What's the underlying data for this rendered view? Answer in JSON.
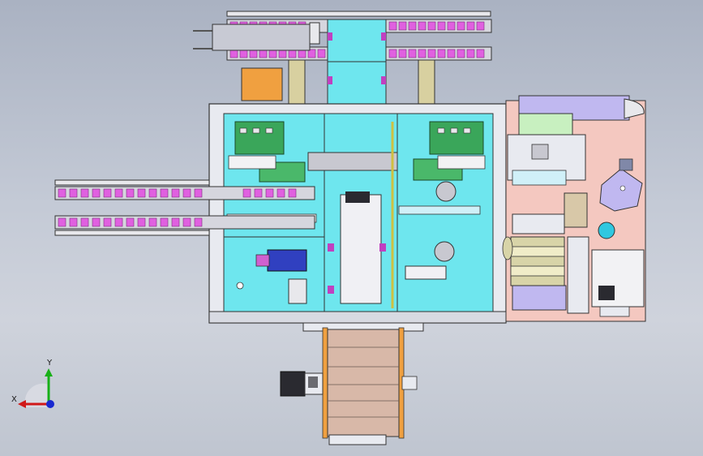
{
  "viewport": {
    "background": "#c4cad6"
  },
  "axis_triad": {
    "x_label": "X",
    "y_label": "Y",
    "x_color": "#d01818",
    "y_color": "#18b018",
    "z_color": "#1828d0"
  },
  "colors": {
    "frame": "#e8eaf0",
    "cyan_panel": "#6ee6ee",
    "green_board": "#3aa65a",
    "magenta_roller": "#e060e0",
    "tan_column": "#d8d0a0",
    "orange_block": "#f0a040",
    "beige_drum": "#d8b8a8",
    "right_module": "#f4c8c0",
    "lavender_panel": "#c0b8f0"
  }
}
